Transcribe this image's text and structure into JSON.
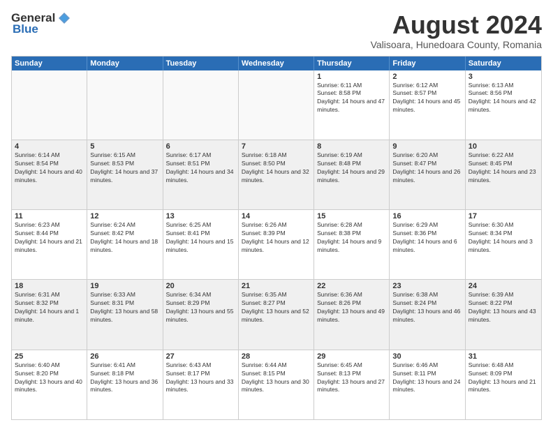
{
  "logo": {
    "general": "General",
    "blue": "Blue"
  },
  "title": "August 2024",
  "subtitle": "Valisoara, Hunedoara County, Romania",
  "days_of_week": [
    "Sunday",
    "Monday",
    "Tuesday",
    "Wednesday",
    "Thursday",
    "Friday",
    "Saturday"
  ],
  "weeks": [
    [
      {
        "day": "",
        "info": ""
      },
      {
        "day": "",
        "info": ""
      },
      {
        "day": "",
        "info": ""
      },
      {
        "day": "",
        "info": ""
      },
      {
        "day": "1",
        "info": "Sunrise: 6:11 AM\nSunset: 8:58 PM\nDaylight: 14 hours and 47 minutes."
      },
      {
        "day": "2",
        "info": "Sunrise: 6:12 AM\nSunset: 8:57 PM\nDaylight: 14 hours and 45 minutes."
      },
      {
        "day": "3",
        "info": "Sunrise: 6:13 AM\nSunset: 8:56 PM\nDaylight: 14 hours and 42 minutes."
      }
    ],
    [
      {
        "day": "4",
        "info": "Sunrise: 6:14 AM\nSunset: 8:54 PM\nDaylight: 14 hours and 40 minutes."
      },
      {
        "day": "5",
        "info": "Sunrise: 6:15 AM\nSunset: 8:53 PM\nDaylight: 14 hours and 37 minutes."
      },
      {
        "day": "6",
        "info": "Sunrise: 6:17 AM\nSunset: 8:51 PM\nDaylight: 14 hours and 34 minutes."
      },
      {
        "day": "7",
        "info": "Sunrise: 6:18 AM\nSunset: 8:50 PM\nDaylight: 14 hours and 32 minutes."
      },
      {
        "day": "8",
        "info": "Sunrise: 6:19 AM\nSunset: 8:48 PM\nDaylight: 14 hours and 29 minutes."
      },
      {
        "day": "9",
        "info": "Sunrise: 6:20 AM\nSunset: 8:47 PM\nDaylight: 14 hours and 26 minutes."
      },
      {
        "day": "10",
        "info": "Sunrise: 6:22 AM\nSunset: 8:45 PM\nDaylight: 14 hours and 23 minutes."
      }
    ],
    [
      {
        "day": "11",
        "info": "Sunrise: 6:23 AM\nSunset: 8:44 PM\nDaylight: 14 hours and 21 minutes."
      },
      {
        "day": "12",
        "info": "Sunrise: 6:24 AM\nSunset: 8:42 PM\nDaylight: 14 hours and 18 minutes."
      },
      {
        "day": "13",
        "info": "Sunrise: 6:25 AM\nSunset: 8:41 PM\nDaylight: 14 hours and 15 minutes."
      },
      {
        "day": "14",
        "info": "Sunrise: 6:26 AM\nSunset: 8:39 PM\nDaylight: 14 hours and 12 minutes."
      },
      {
        "day": "15",
        "info": "Sunrise: 6:28 AM\nSunset: 8:38 PM\nDaylight: 14 hours and 9 minutes."
      },
      {
        "day": "16",
        "info": "Sunrise: 6:29 AM\nSunset: 8:36 PM\nDaylight: 14 hours and 6 minutes."
      },
      {
        "day": "17",
        "info": "Sunrise: 6:30 AM\nSunset: 8:34 PM\nDaylight: 14 hours and 3 minutes."
      }
    ],
    [
      {
        "day": "18",
        "info": "Sunrise: 6:31 AM\nSunset: 8:32 PM\nDaylight: 14 hours and 1 minute."
      },
      {
        "day": "19",
        "info": "Sunrise: 6:33 AM\nSunset: 8:31 PM\nDaylight: 13 hours and 58 minutes."
      },
      {
        "day": "20",
        "info": "Sunrise: 6:34 AM\nSunset: 8:29 PM\nDaylight: 13 hours and 55 minutes."
      },
      {
        "day": "21",
        "info": "Sunrise: 6:35 AM\nSunset: 8:27 PM\nDaylight: 13 hours and 52 minutes."
      },
      {
        "day": "22",
        "info": "Sunrise: 6:36 AM\nSunset: 8:26 PM\nDaylight: 13 hours and 49 minutes."
      },
      {
        "day": "23",
        "info": "Sunrise: 6:38 AM\nSunset: 8:24 PM\nDaylight: 13 hours and 46 minutes."
      },
      {
        "day": "24",
        "info": "Sunrise: 6:39 AM\nSunset: 8:22 PM\nDaylight: 13 hours and 43 minutes."
      }
    ],
    [
      {
        "day": "25",
        "info": "Sunrise: 6:40 AM\nSunset: 8:20 PM\nDaylight: 13 hours and 40 minutes."
      },
      {
        "day": "26",
        "info": "Sunrise: 6:41 AM\nSunset: 8:18 PM\nDaylight: 13 hours and 36 minutes."
      },
      {
        "day": "27",
        "info": "Sunrise: 6:43 AM\nSunset: 8:17 PM\nDaylight: 13 hours and 33 minutes."
      },
      {
        "day": "28",
        "info": "Sunrise: 6:44 AM\nSunset: 8:15 PM\nDaylight: 13 hours and 30 minutes."
      },
      {
        "day": "29",
        "info": "Sunrise: 6:45 AM\nSunset: 8:13 PM\nDaylight: 13 hours and 27 minutes."
      },
      {
        "day": "30",
        "info": "Sunrise: 6:46 AM\nSunset: 8:11 PM\nDaylight: 13 hours and 24 minutes."
      },
      {
        "day": "31",
        "info": "Sunrise: 6:48 AM\nSunset: 8:09 PM\nDaylight: 13 hours and 21 minutes."
      }
    ]
  ]
}
